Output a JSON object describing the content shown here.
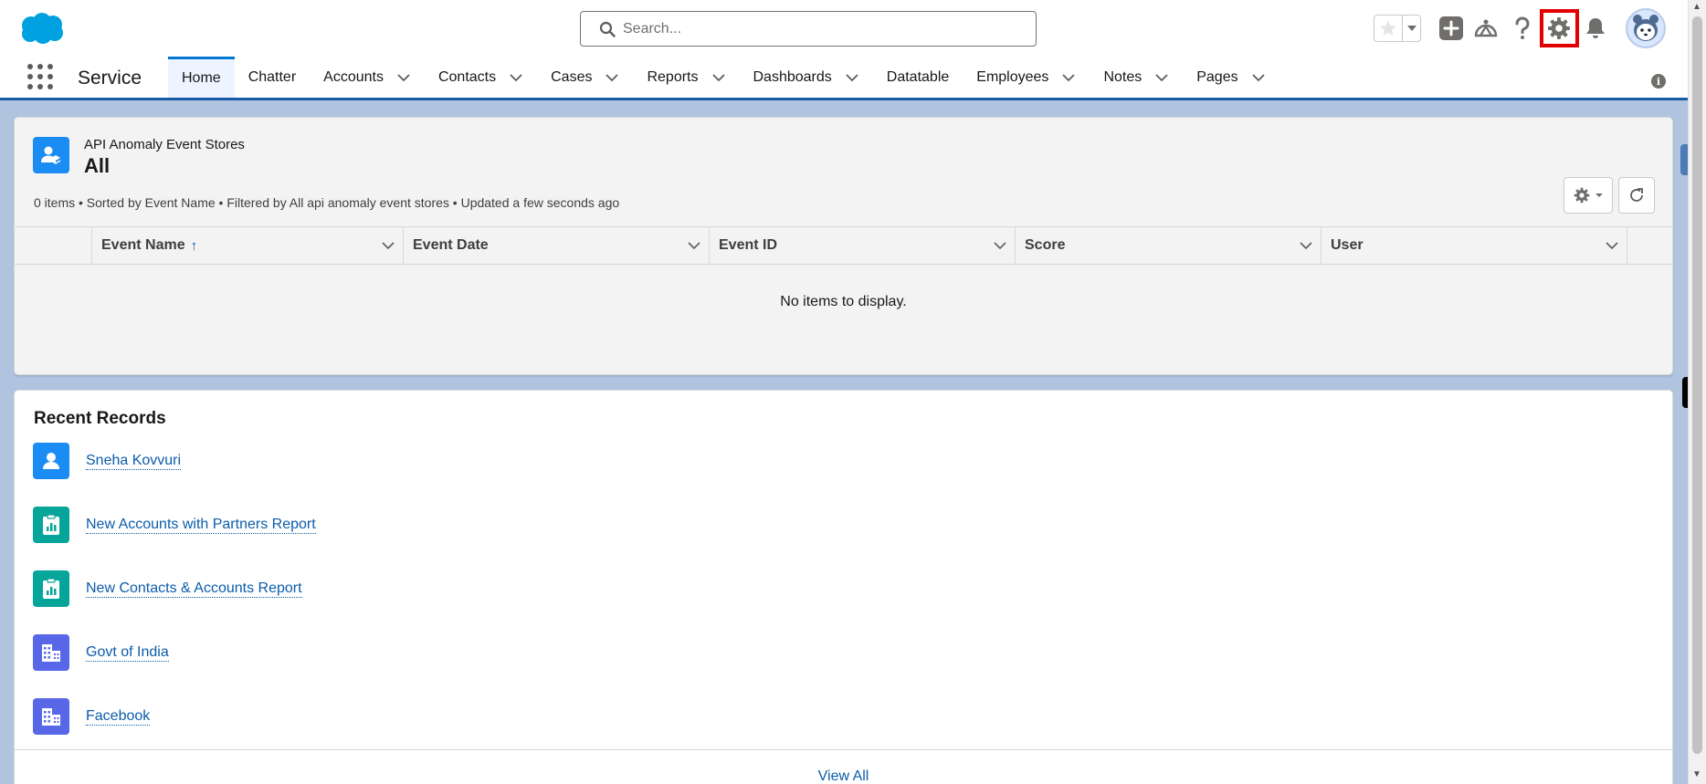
{
  "header": {
    "search_placeholder": "Search...",
    "colors": {
      "brand": "#00a1e0",
      "setup_highlight": "#e50000"
    }
  },
  "nav": {
    "app_name": "Service",
    "tabs": [
      {
        "label": "Home",
        "active": true,
        "has_menu": false
      },
      {
        "label": "Chatter",
        "active": false,
        "has_menu": false
      },
      {
        "label": "Accounts",
        "active": false,
        "has_menu": true
      },
      {
        "label": "Contacts",
        "active": false,
        "has_menu": true
      },
      {
        "label": "Cases",
        "active": false,
        "has_menu": true
      },
      {
        "label": "Reports",
        "active": false,
        "has_menu": true
      },
      {
        "label": "Dashboards",
        "active": false,
        "has_menu": true
      },
      {
        "label": "Datatable",
        "active": false,
        "has_menu": false
      },
      {
        "label": "Employees",
        "active": false,
        "has_menu": true
      },
      {
        "label": "Notes",
        "active": false,
        "has_menu": true
      },
      {
        "label": "Pages",
        "active": false,
        "has_menu": true
      }
    ],
    "info_glyph": "i"
  },
  "list_view": {
    "object_name": "API Anomaly Event Stores",
    "view_name": "All",
    "meta": "0 items • Sorted by Event Name • Filtered by All api anomaly event stores • Updated a few seconds ago",
    "columns": [
      {
        "label": "Event Name",
        "sorted": true
      },
      {
        "label": "Event Date",
        "sorted": false
      },
      {
        "label": "Event ID",
        "sorted": false
      },
      {
        "label": "Score",
        "sorted": false
      },
      {
        "label": "User",
        "sorted": false
      }
    ],
    "sort_arrow": "↑",
    "empty_message": "No items to display."
  },
  "recent_records": {
    "title": "Recent Records",
    "items": [
      {
        "label": "Sneha Kovvuri",
        "icon": "contact-icon",
        "color": "#1a8cf3"
      },
      {
        "label": "New Accounts with Partners Report",
        "icon": "report-icon",
        "color": "#06a59a"
      },
      {
        "label": "New Contacts & Accounts Report",
        "icon": "report-icon",
        "color": "#06a59a"
      },
      {
        "label": "Govt of India",
        "icon": "account-icon",
        "color": "#5867e8"
      },
      {
        "label": "Facebook",
        "icon": "account-icon",
        "color": "#5867e8"
      }
    ],
    "view_all": "View All"
  }
}
